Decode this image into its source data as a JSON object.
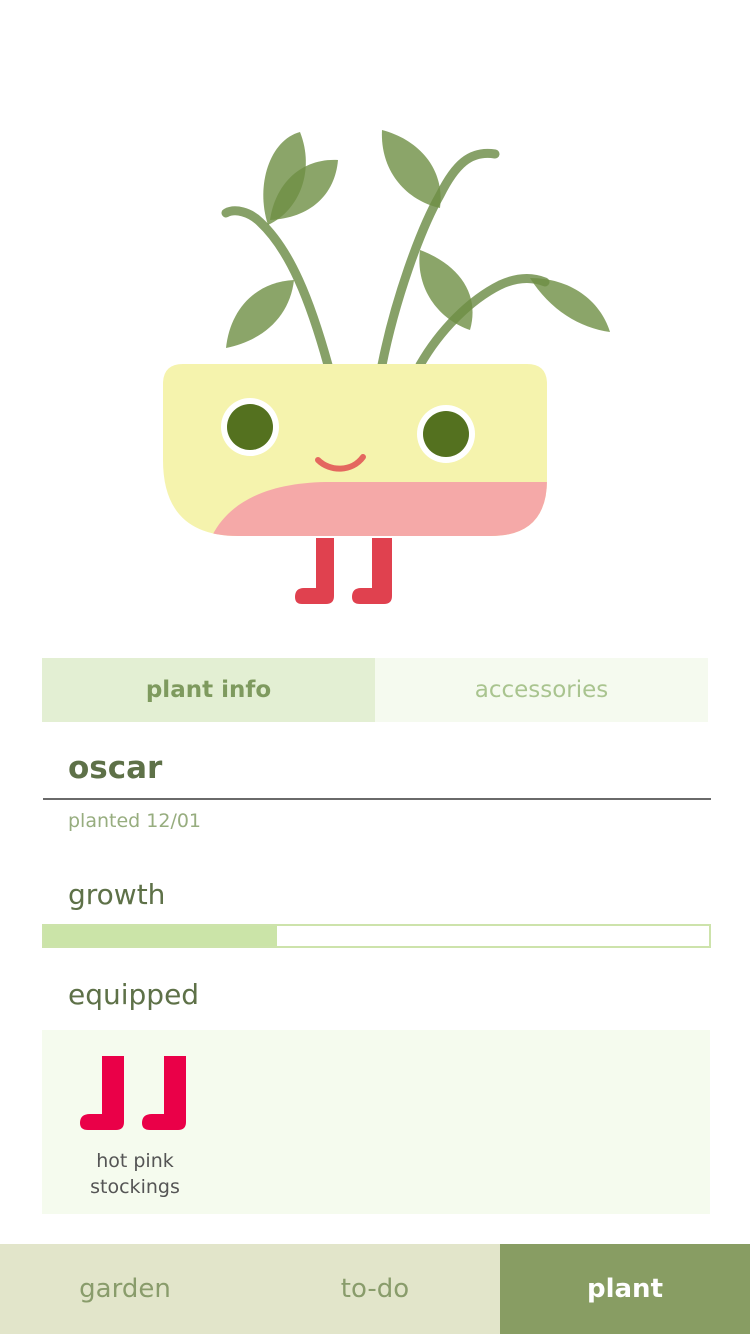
{
  "icons": {
    "plant_character": "potted-plant-character-with-boots",
    "equipped_item": "boots-icon"
  },
  "colors": {
    "accent": "#889d63",
    "boots": "#e0414f",
    "stockings": "#ea0048",
    "pot_yellow": "#f5f3ad",
    "pot_pink": "#f5a9a8",
    "leaf": "#6e8f44"
  },
  "tabs": {
    "plant_info": "plant info",
    "accessories": "accessories",
    "active": "plant info"
  },
  "plant": {
    "name": "oscar",
    "planted": "planted 12/01"
  },
  "growth": {
    "label": "growth",
    "progress": 0.35
  },
  "equipped": {
    "label": "equipped",
    "items": [
      {
        "name": "hot pink stockings"
      }
    ]
  },
  "nav": {
    "items": [
      "garden",
      "to-do",
      "plant"
    ],
    "active": "plant"
  }
}
